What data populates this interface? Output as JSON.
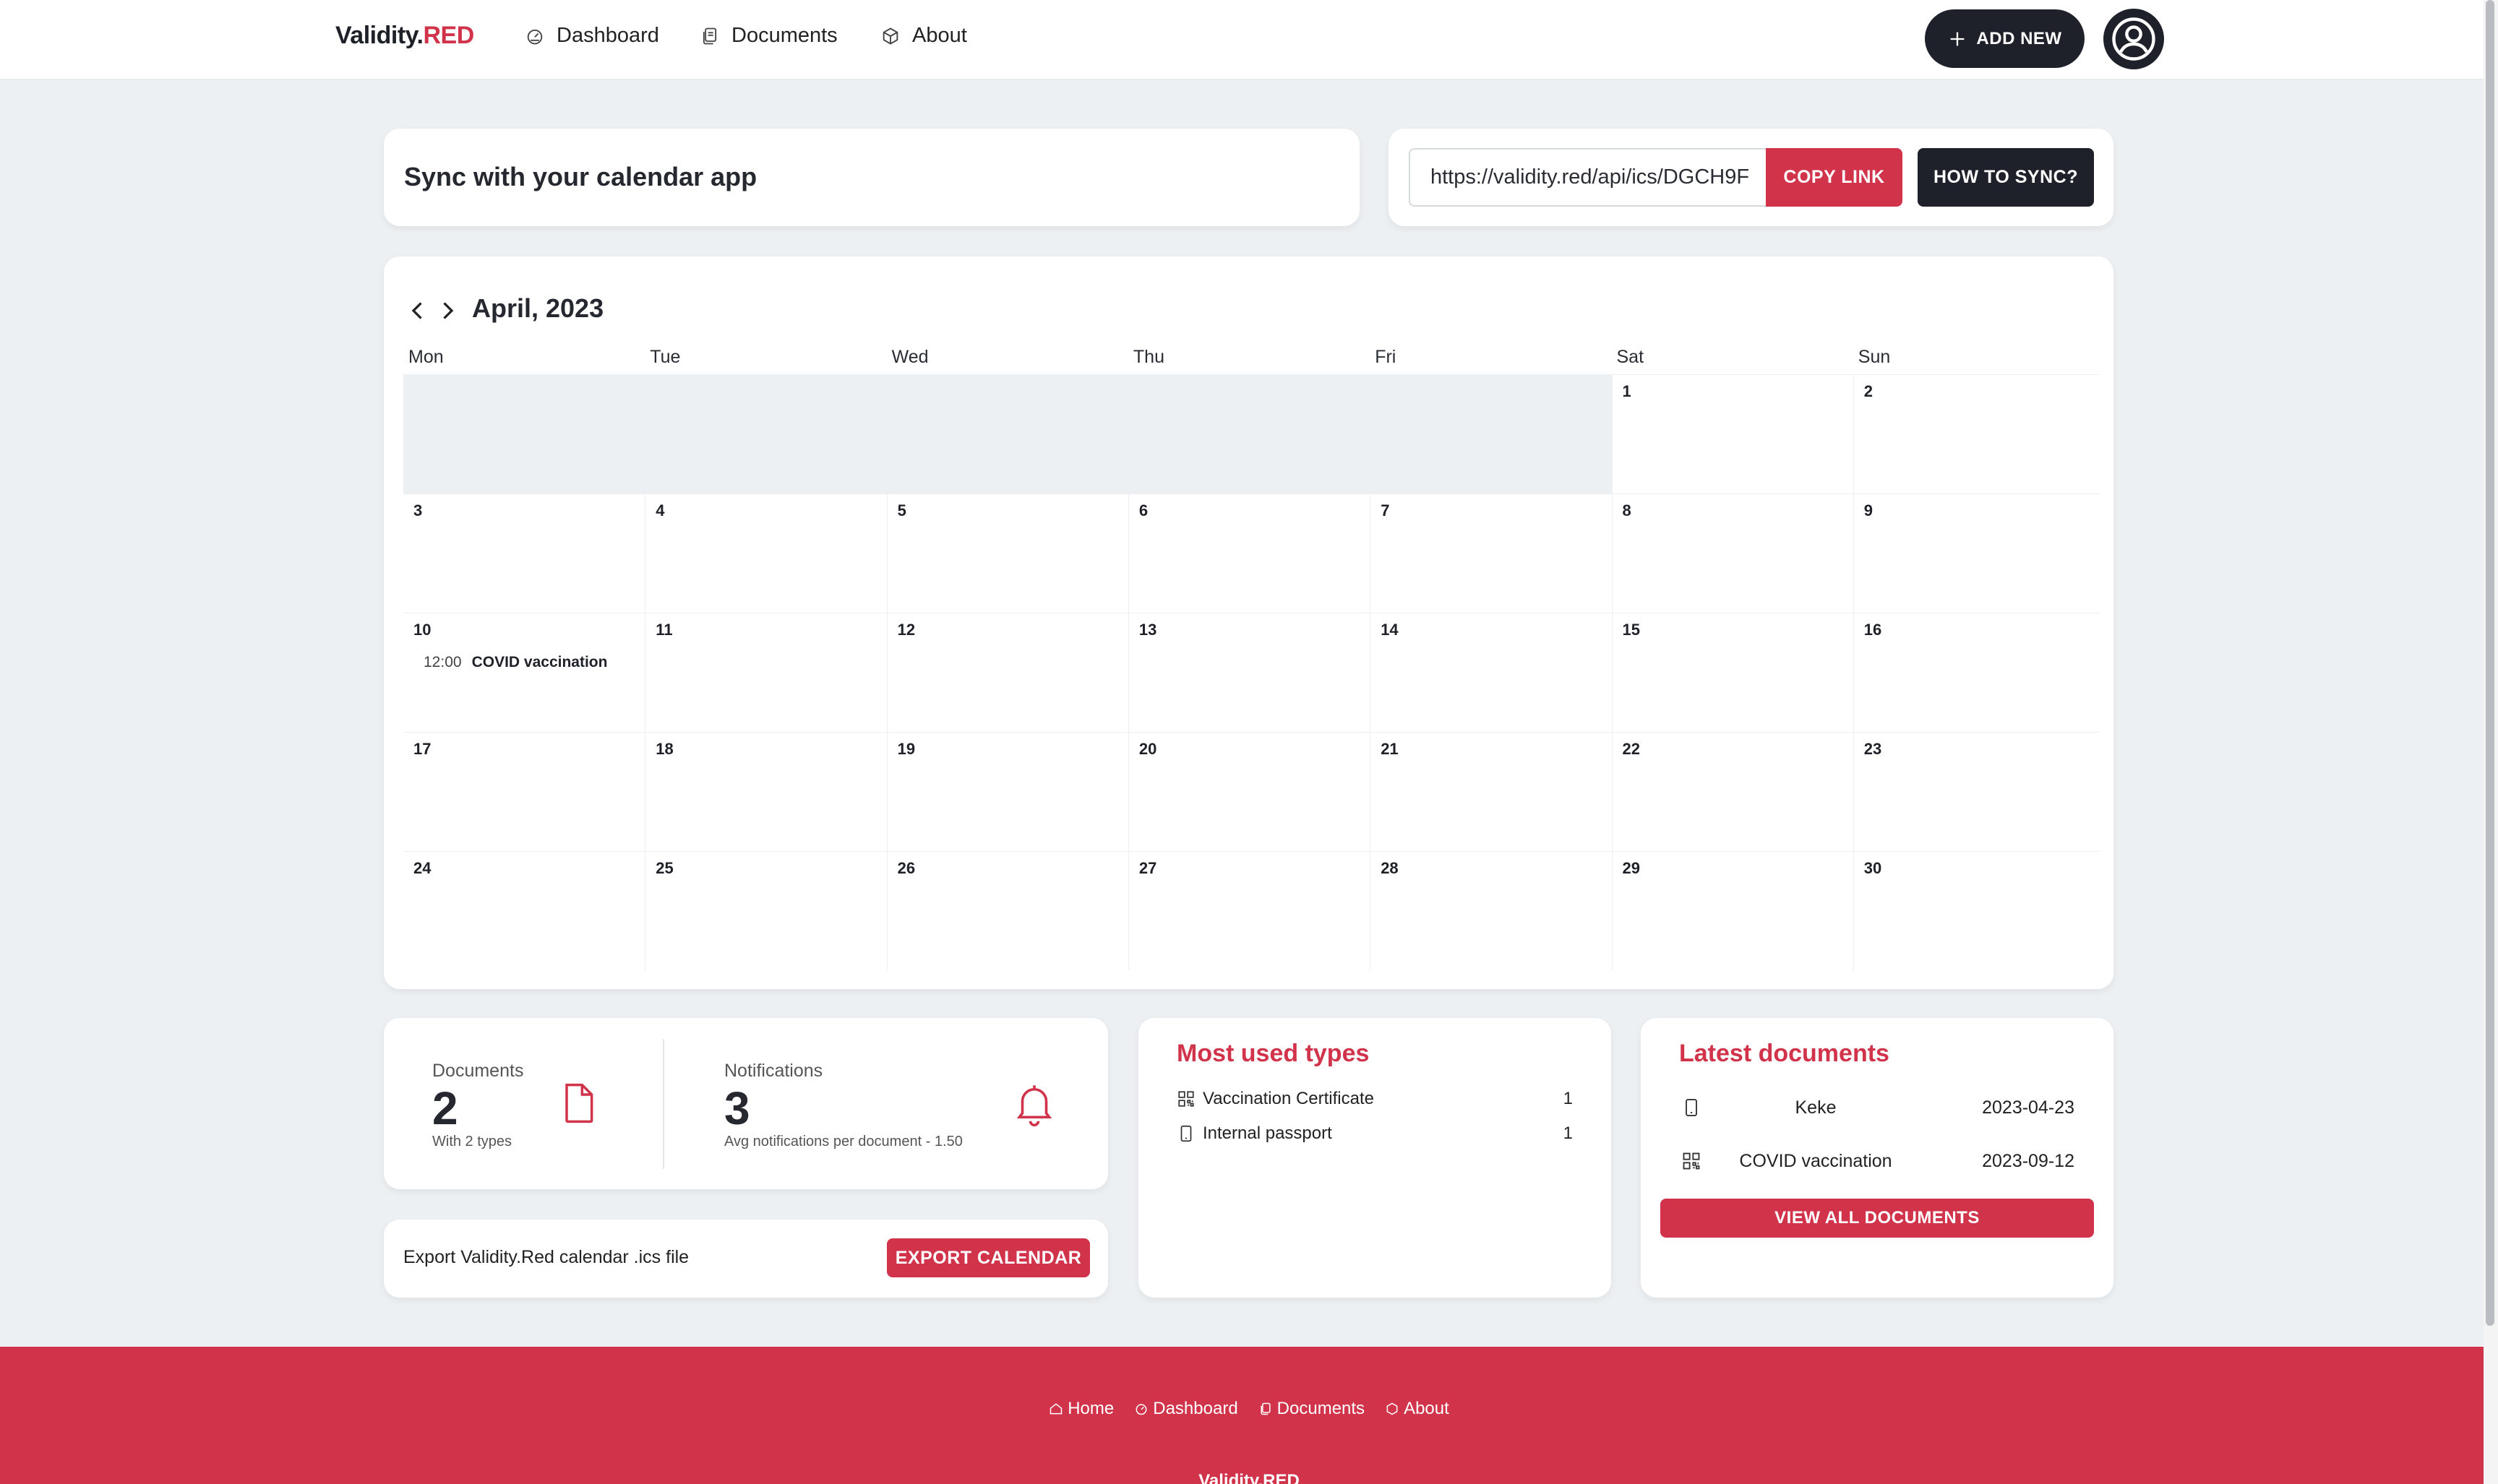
{
  "nav": {
    "brand_main": "Validity.",
    "brand_accent": "RED",
    "links": [
      {
        "label": "Dashboard",
        "icon": "dashboard-icon"
      },
      {
        "label": "Documents",
        "icon": "documents-icon"
      },
      {
        "label": "About",
        "icon": "cube-icon"
      }
    ],
    "add_new_label": "ADD NEW"
  },
  "sync": {
    "title": "Sync with your calendar app",
    "url": "https://validity.red/api/ics/DGCH9F",
    "copy_label": "COPY LINK",
    "howto_label": "HOW TO SYNC?"
  },
  "calendar": {
    "month_label": "April, 2023",
    "weekdays": [
      "Mon",
      "Tue",
      "Wed",
      "Thu",
      "Fri",
      "Sat",
      "Sun"
    ],
    "first_weekday_index": 5,
    "days_in_month": 30,
    "events": [
      {
        "day": 10,
        "time": "12:00",
        "title": "COVID vaccination"
      }
    ]
  },
  "stats": {
    "documents_label": "Documents",
    "documents_value": "2",
    "documents_desc": "With 2 types",
    "notifications_label": "Notifications",
    "notifications_value": "3",
    "notifications_desc": "Avg notifications per document - 1.50"
  },
  "export": {
    "text": "Export Validity.Red calendar .ics file",
    "button_label": "EXPORT CALENDAR"
  },
  "types": {
    "title": "Most used types",
    "items": [
      {
        "name": "Vaccination Certificate",
        "count": "1",
        "icon": "qr-code-icon"
      },
      {
        "name": "Internal passport",
        "count": "1",
        "icon": "phone-icon"
      }
    ]
  },
  "latest": {
    "title": "Latest documents",
    "items": [
      {
        "name": "Keke",
        "date": "2023-04-23",
        "icon": "phone-icon"
      },
      {
        "name": "COVID vaccination",
        "date": "2023-09-12",
        "icon": "qr-code-icon"
      }
    ],
    "view_all_label": "VIEW ALL DOCUMENTS"
  },
  "footer": {
    "links": [
      "Home",
      "Dashboard",
      "Documents",
      "About"
    ],
    "brand": "Validity.RED"
  },
  "colors": {
    "accent": "#d0334a",
    "dark": "#1e2129",
    "background": "#ecf0f2"
  }
}
